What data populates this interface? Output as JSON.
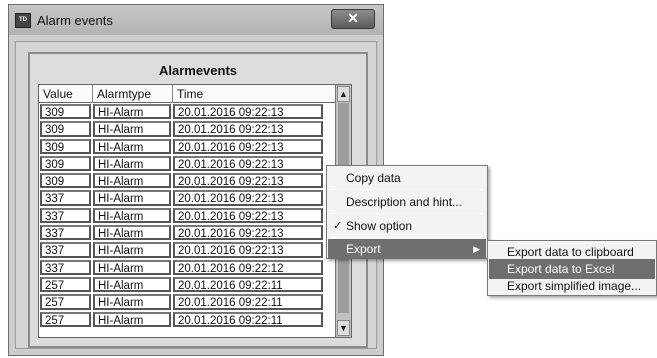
{
  "window": {
    "title": "Alarm events",
    "app_icon_text": "TD",
    "close_glyph": "✕"
  },
  "group": {
    "title": "Alarmevents"
  },
  "table": {
    "columns": [
      "Value",
      "Alarmtype",
      "Time"
    ],
    "rows": [
      [
        "309",
        "HI-Alarm",
        "20.01.2016 09:22:13"
      ],
      [
        "309",
        "HI-Alarm",
        "20.01.2016 09:22:13"
      ],
      [
        "309",
        "HI-Alarm",
        "20.01.2016 09:22:13"
      ],
      [
        "309",
        "HI-Alarm",
        "20.01.2016 09:22:13"
      ],
      [
        "309",
        "HI-Alarm",
        "20.01.2016 09:22:13"
      ],
      [
        "337",
        "HI-Alarm",
        "20.01.2016 09:22:13"
      ],
      [
        "337",
        "HI-Alarm",
        "20.01.2016 09:22:13"
      ],
      [
        "337",
        "HI-Alarm",
        "20.01.2016 09:22:13"
      ],
      [
        "337",
        "HI-Alarm",
        "20.01.2016 09:22:13"
      ],
      [
        "337",
        "HI-Alarm",
        "20.01.2016 09:22:12"
      ],
      [
        "257",
        "HI-Alarm",
        "20.01.2016 09:22:11"
      ],
      [
        "257",
        "HI-Alarm",
        "20.01.2016 09:22:11"
      ],
      [
        "257",
        "HI-Alarm",
        "20.01.2016 09:22:11"
      ]
    ],
    "scroll_up_glyph": "▲",
    "scroll_down_glyph": "▼"
  },
  "context_menu": {
    "copy_data": "Copy data",
    "description_hint": "Description and hint...",
    "show_option": "Show option",
    "show_option_check": "✓",
    "export": "Export",
    "export_arrow": "▶"
  },
  "export_submenu": {
    "to_clipboard": "Export data to clipboard",
    "to_excel": "Export data to Excel",
    "simplified_image": "Export simplified image..."
  },
  "colors": {
    "highlight": "#6f6f6f",
    "menu_background": "#f3f3f3"
  }
}
